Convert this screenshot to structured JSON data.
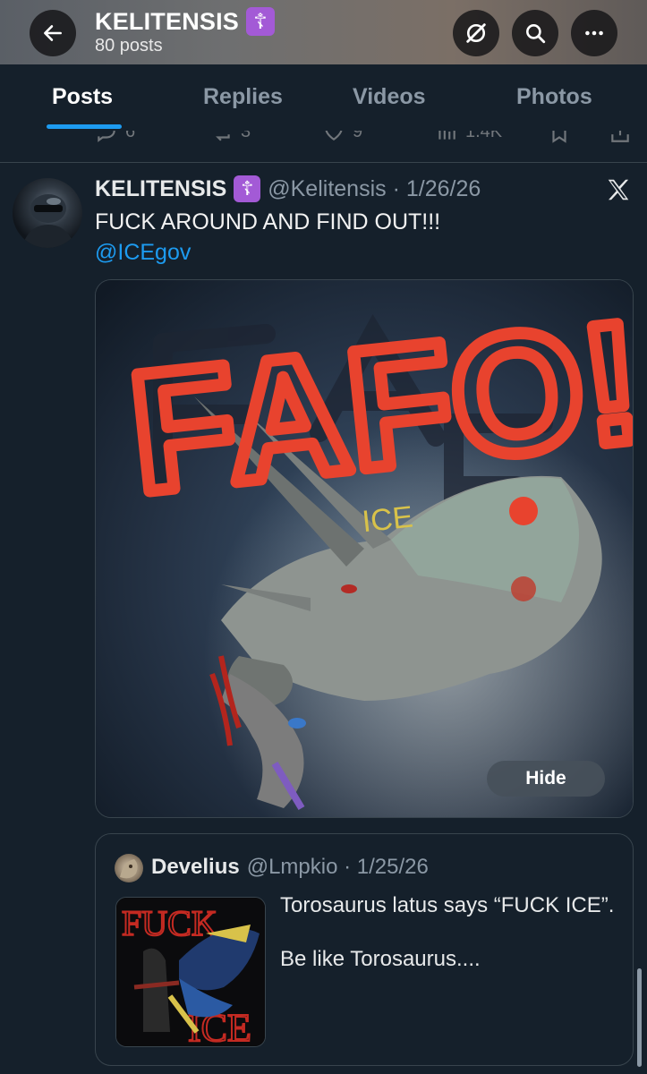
{
  "header": {
    "title": "KELITENSIS",
    "badge": "☦",
    "subtitle": "80 posts"
  },
  "icons": {
    "back": "back-arrow-icon",
    "grok": "grok-icon",
    "search": "search-icon",
    "more": "more-icon",
    "x": "x-logo-icon"
  },
  "tabs": [
    {
      "label": "Posts",
      "active": true
    },
    {
      "label": "Replies",
      "active": false
    },
    {
      "label": "Videos",
      "active": false
    },
    {
      "label": "Photos",
      "active": false
    }
  ],
  "prev_actions": {
    "replies": "6",
    "reposts": "3",
    "likes": "9",
    "views": "1.4K"
  },
  "tweet": {
    "name": "KELITENSIS",
    "badge": "☦",
    "handle_date": "@Kelitensis · 1/26/26",
    "text": "FUCK AROUND AND FIND OUT!!!",
    "mention": "@ICEgov",
    "media_text": {
      "headline": "FAFO!",
      "label": "ICE"
    },
    "hide_label": "Hide"
  },
  "quote": {
    "name": "Develius",
    "handle_date": "@Lmpkio · 1/25/26",
    "text_line1": "Torosaurus latus says “FUCK ICE”.",
    "text_line2": "Be like Torosaurus....",
    "thumb_text": {
      "top": "FUCK",
      "bottom": "ICE"
    }
  },
  "colors": {
    "background": "#15202b",
    "accent": "#1d9bf0",
    "badge": "#a35ad6",
    "paint_red": "#e8432e"
  }
}
